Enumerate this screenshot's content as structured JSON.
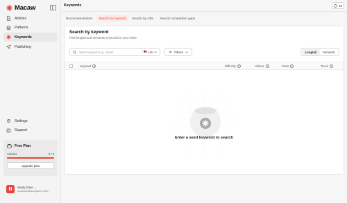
{
  "app": {
    "name": "Macaw"
  },
  "sidebar": {
    "items": [
      {
        "label": "Articles",
        "icon": "articles-icon",
        "active": false
      },
      {
        "label": "Patterns",
        "icon": "patterns-icon",
        "active": false
      },
      {
        "label": "Keywords",
        "icon": "keywords-icon",
        "active": true
      },
      {
        "label": "Publishing",
        "icon": "publishing-icon",
        "active": false
      }
    ],
    "bottom": [
      {
        "label": "Settings",
        "icon": "gear-icon"
      },
      {
        "label": "Support",
        "icon": "support-icon"
      }
    ],
    "plan": {
      "name": "Free Plan",
      "usage_label": "Articles",
      "usage_value": "3 / 3",
      "usage_fraction": 1.0,
      "upgrade_label": "Upgrade plan"
    },
    "user": {
      "initial": "N",
      "name": "Nicely Done →",
      "email": "products@nicelydone.club"
    }
  },
  "header": {
    "title": "Keywords",
    "credits": "10"
  },
  "tabs": [
    {
      "label": "Recommendations",
      "active": false
    },
    {
      "label": "Search by keyword",
      "active": true
    },
    {
      "label": "Search by URL",
      "active": false
    },
    {
      "label": "Search competition gaps",
      "active": false
    }
  ],
  "panel": {
    "title": "Search by keyword",
    "subtitle": "Find longtail and semantic keywords in your niche",
    "search": {
      "placeholder": "Seed keyword e.g. shoes",
      "country": "US"
    },
    "filters_label": "Filters",
    "segments": [
      {
        "label": "Longtail",
        "active": true
      },
      {
        "label": "Semantic",
        "active": false
      }
    ],
    "columns": {
      "keyword": "Keyword",
      "difficulty": "Difficulty",
      "volume": "Volume",
      "intent": "Intent",
      "trend": "Trend"
    },
    "empty_text": "Enter a seed keyword to search"
  },
  "colors": {
    "accent": "#e8453c",
    "accent_light": "#fde9e7",
    "background": "#f6f6f6"
  }
}
